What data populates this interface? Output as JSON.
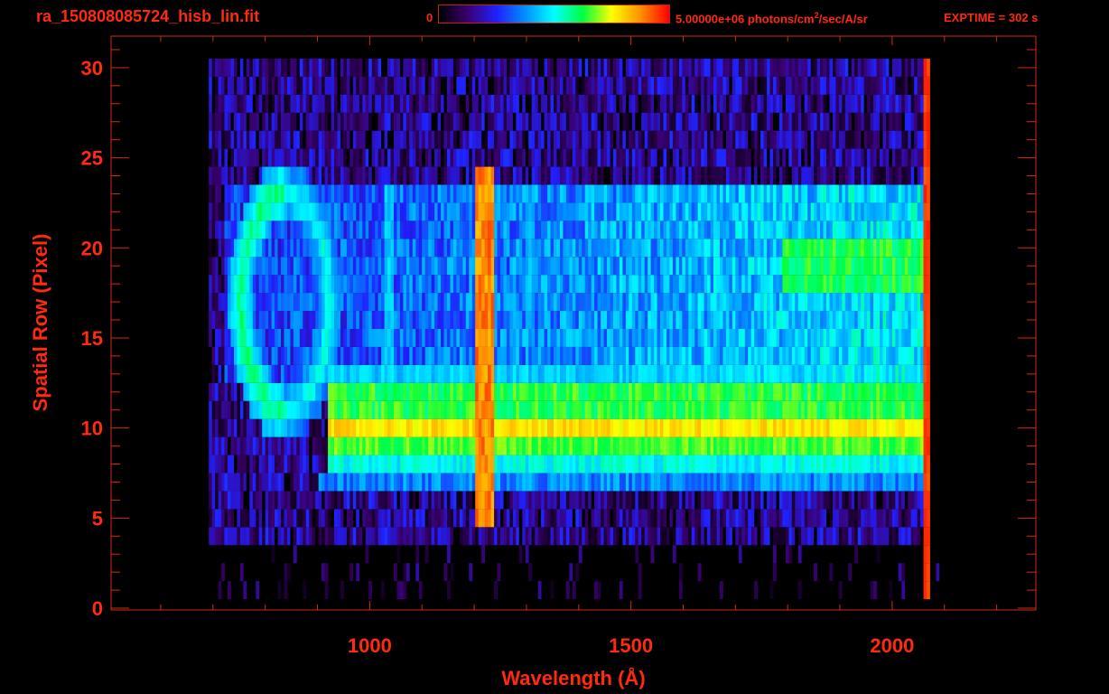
{
  "header": {
    "filename": "ra_150808085724_hisb_lin.fit",
    "colorbar_min_label": "0",
    "colorbar_max_value": "5.00000e+06 photons/cm",
    "colorbar_units_sup": "2",
    "colorbar_units_rest": "/sec/A/sr",
    "exptime": "EXPTIME = 302 s"
  },
  "colors": {
    "axis": "#d42a14",
    "text": "#ff2a10",
    "background": "#000000",
    "colormap": [
      "#000000",
      "#3a0070",
      "#2020ff",
      "#0090ff",
      "#00ffff",
      "#00ff40",
      "#ffff00",
      "#ff9000",
      "#ff0000"
    ]
  },
  "chart_data": {
    "type": "heatmap",
    "title": "ra_150808085724_hisb_lin.fit",
    "xlabel": "Wavelength (Å)",
    "ylabel": "Spatial Row (Pixel)",
    "xlim": [
      505,
      2275
    ],
    "ylim": [
      -0.1,
      31.75
    ],
    "x_major_ticks": [
      1000,
      1500,
      2000
    ],
    "x_tick_labels": [
      "1000",
      "1500",
      "2000"
    ],
    "x_minor_step": 100,
    "y_major_ticks": [
      0,
      5,
      10,
      15,
      20,
      25,
      30
    ],
    "y_tick_labels": [
      "0",
      "5",
      "10",
      "15",
      "20",
      "25",
      "30"
    ],
    "y_minor_step": 1,
    "colorbar": {
      "min": 0,
      "max": 5000000,
      "units": "photons/cm^2/sec/A/sr"
    },
    "value_scale": "fraction of colorbar max",
    "wavelength_bin": 6,
    "features": [
      {
        "name": "detector-background",
        "shape": "rect",
        "x": [
          690,
          2070
        ],
        "rows": [
          4,
          30
        ],
        "level": 0.14,
        "noise": 0.13
      },
      {
        "name": "sparse-low-rows",
        "shape": "rect",
        "x": [
          700,
          2085
        ],
        "rows": [
          1,
          3
        ],
        "level": 0.06,
        "noise": 0.12
      },
      {
        "name": "diffuse-band",
        "shape": "rect",
        "x": [
          720,
          2060
        ],
        "rows": [
          13,
          23
        ],
        "level": 0.27,
        "level_end": 0.48,
        "noise": 0.1
      },
      {
        "name": "ring-feature",
        "shape": "ring",
        "center": [
          835,
          17
        ],
        "radius_x": 85,
        "radius_rows": 6,
        "width": 0.28,
        "level": 0.52
      },
      {
        "name": "red-end-rows-18-20",
        "shape": "rect",
        "x": [
          1790,
          2060
        ],
        "rows": [
          18,
          20
        ],
        "level": 0.62,
        "noise": 0.06
      },
      {
        "name": "row-13-band",
        "shape": "rect",
        "x": [
          880,
          2060
        ],
        "rows": [
          13,
          13
        ],
        "level": 0.44,
        "noise": 0.05
      },
      {
        "name": "rows-11-12-band",
        "shape": "rect",
        "x": [
          920,
          2060
        ],
        "rows": [
          11,
          12
        ],
        "level": 0.63,
        "noise": 0.06
      },
      {
        "name": "row-10-band",
        "shape": "rect",
        "x": [
          920,
          2060
        ],
        "rows": [
          10,
          10
        ],
        "level": 0.78,
        "noise": 0.05
      },
      {
        "name": "row-9-band",
        "shape": "rect",
        "x": [
          920,
          2060
        ],
        "rows": [
          9,
          9
        ],
        "level": 0.66,
        "noise": 0.05
      },
      {
        "name": "row-8-band",
        "shape": "rect",
        "x": [
          920,
          2060
        ],
        "rows": [
          8,
          8
        ],
        "level": 0.5,
        "noise": 0.06
      },
      {
        "name": "row-7-band",
        "shape": "rect",
        "x": [
          900,
          2060
        ],
        "rows": [
          7,
          7
        ],
        "level": 0.36,
        "noise": 0.08
      },
      {
        "name": "lyman-alpha-line",
        "shape": "rect",
        "x": [
          1198,
          1232
        ],
        "rows": [
          5,
          24
        ],
        "level": 0.88,
        "noise": 0.06
      },
      {
        "name": "line-1030",
        "shape": "rect",
        "x": [
          1025,
          1045
        ],
        "rows": [
          14,
          23
        ],
        "level": 0.44,
        "noise": 0.04
      },
      {
        "name": "line-1304",
        "shape": "rect",
        "x": [
          1296,
          1310
        ],
        "rows": [
          15,
          23
        ],
        "level": 0.4,
        "noise": 0.04
      },
      {
        "name": "detector-edge",
        "shape": "rect",
        "x": [
          2058,
          2068
        ],
        "rows": [
          1,
          30
        ],
        "level": 0.95,
        "noise": 0.03
      }
    ]
  }
}
